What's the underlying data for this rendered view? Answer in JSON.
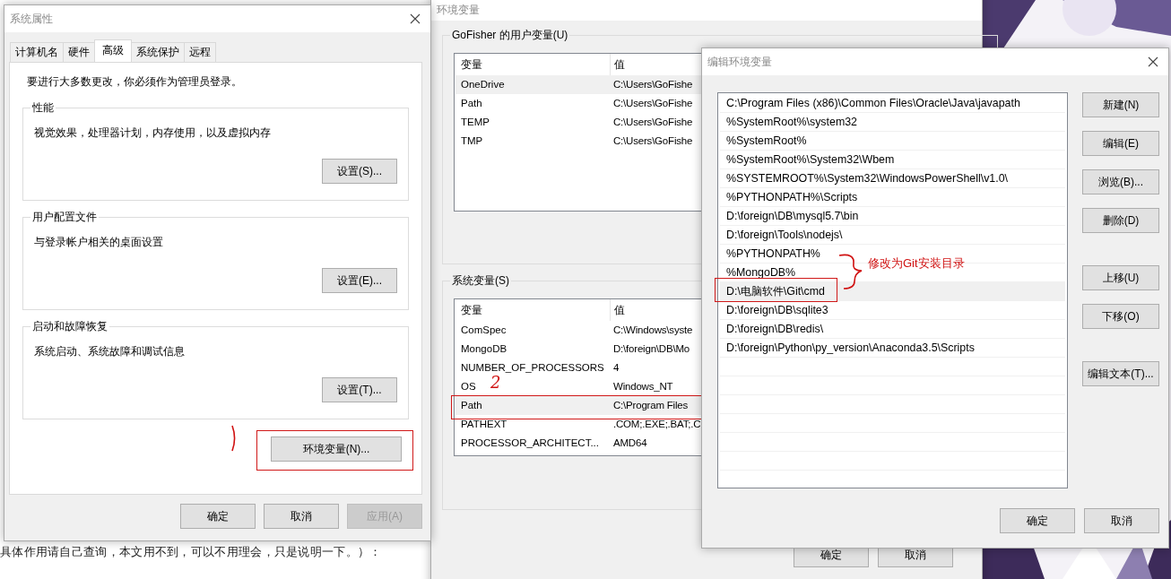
{
  "background_page": {
    "text": "具体作用请自己查询，本文用不到，可以不用理会，只是说明一下。）："
  },
  "system_properties": {
    "title": "系统属性",
    "tabs": [
      {
        "label": "计算机名",
        "selected": false
      },
      {
        "label": "硬件",
        "selected": false
      },
      {
        "label": "高级",
        "selected": true
      },
      {
        "label": "系统保护",
        "selected": false
      },
      {
        "label": "远程",
        "selected": false
      }
    ],
    "notice": "要进行大多数更改，你必须作为管理员登录。",
    "groups": [
      {
        "title": "性能",
        "description": "视觉效果，处理器计划，内存使用，以及虚拟内存",
        "button": "设置(S)..."
      },
      {
        "title": "用户配置文件",
        "description": "与登录帐户相关的桌面设置",
        "button": "设置(E)..."
      },
      {
        "title": "启动和故障恢复",
        "description": "系统启动、系统故障和调试信息",
        "button": "设置(T)..."
      }
    ],
    "env_button": {
      "label": "环境变量(N)...",
      "annotated": true
    },
    "pen_stroke": true,
    "buttons": [
      {
        "label": "确定",
        "disabled": false
      },
      {
        "label": "取消",
        "disabled": false
      },
      {
        "label": "应用(A)",
        "disabled": true
      }
    ]
  },
  "environment_variables": {
    "title": "环境变量",
    "user_group": {
      "title": "GoFisher 的用户变量(U)",
      "columns": [
        "变量",
        "值"
      ],
      "rows": [
        {
          "name": "OneDrive",
          "value": "C:\\Users\\GoFishe",
          "selected": true,
          "annotated": false
        },
        {
          "name": "Path",
          "value": "C:\\Users\\GoFishe",
          "selected": false,
          "annotated": false
        },
        {
          "name": "TEMP",
          "value": "C:\\Users\\GoFishe",
          "selected": false,
          "annotated": false
        },
        {
          "name": "TMP",
          "value": "C:\\Users\\GoFishe",
          "selected": false,
          "annotated": false
        }
      ]
    },
    "system_group": {
      "title": "系统变量(S)",
      "step_mark": "2",
      "columns": [
        "变量",
        "值"
      ],
      "rows": [
        {
          "name": "ComSpec",
          "value": "C:\\Windows\\syste",
          "selected": false,
          "annotated": false
        },
        {
          "name": "MongoDB",
          "value": "D:\\foreign\\DB\\Mo",
          "selected": false,
          "annotated": false
        },
        {
          "name": "NUMBER_OF_PROCESSORS",
          "value": "4",
          "selected": false,
          "annotated": false
        },
        {
          "name": "OS",
          "value": "Windows_NT",
          "selected": false,
          "annotated": false
        },
        {
          "name": "Path",
          "value": "C:\\Program Files",
          "selected": true,
          "annotated": true
        },
        {
          "name": "PATHEXT",
          "value": ".COM;.EXE;.BAT;.C",
          "selected": false,
          "annotated": false
        },
        {
          "name": "PROCESSOR_ARCHITECT...",
          "value": "AMD64",
          "selected": false,
          "annotated": false
        }
      ]
    },
    "buttons": [
      "确定",
      "取消"
    ]
  },
  "edit_environment_variable": {
    "title": "编辑环境变量",
    "entries": [
      {
        "text": "C:\\Program Files (x86)\\Common Files\\Oracle\\Java\\javapath",
        "selected": false,
        "annotated": false
      },
      {
        "text": "%SystemRoot%\\system32",
        "selected": false,
        "annotated": false
      },
      {
        "text": "%SystemRoot%",
        "selected": false,
        "annotated": false
      },
      {
        "text": "%SystemRoot%\\System32\\Wbem",
        "selected": false,
        "annotated": false
      },
      {
        "text": "%SYSTEMROOT%\\System32\\WindowsPowerShell\\v1.0\\",
        "selected": false,
        "annotated": false
      },
      {
        "text": "%PYTHONPATH%\\Scripts",
        "selected": false,
        "annotated": false
      },
      {
        "text": "D:\\foreign\\DB\\mysql5.7\\bin",
        "selected": false,
        "annotated": false
      },
      {
        "text": "D:\\foreign\\Tools\\nodejs\\",
        "selected": false,
        "annotated": false
      },
      {
        "text": "%PYTHONPATH%",
        "selected": false,
        "annotated": false
      },
      {
        "text": "%MongoDB%",
        "selected": false,
        "annotated": false
      },
      {
        "text": "D:\\电脑软件\\Git\\cmd",
        "selected": true,
        "annotated": true
      },
      {
        "text": "D:\\foreign\\DB\\sqlite3",
        "selected": false,
        "annotated": false
      },
      {
        "text": "D:\\foreign\\DB\\redis\\",
        "selected": false,
        "annotated": false
      },
      {
        "text": "D:\\foreign\\Python\\py_version\\Anaconda3.5\\Scripts",
        "selected": false,
        "annotated": false
      }
    ],
    "note": "修改为Git安装目录",
    "side_buttons": [
      [
        "新建(N)",
        "编辑(E)",
        "浏览(B)...",
        "删除(D)"
      ],
      [
        "上移(U)",
        "下移(O)"
      ],
      [
        "编辑文本(T)..."
      ]
    ],
    "buttons": [
      "确定",
      "取消"
    ]
  }
}
